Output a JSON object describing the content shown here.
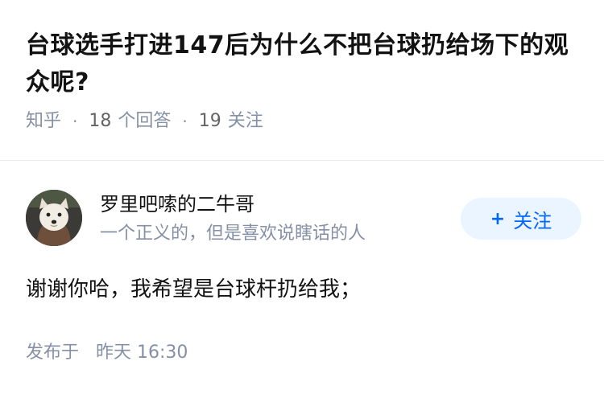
{
  "question": {
    "title": "台球选手打进147后为什么不把台球扔给场下的观众呢?",
    "source": "知乎",
    "separator": "·",
    "answers_count": "18",
    "answers_label": "个回答",
    "followers_count": "19",
    "followers_label": "关注"
  },
  "author": {
    "name": "罗里吧嗦的二牛哥",
    "bio": "一个正义的，但是喜欢说瞎话的人",
    "avatar_icon": "dog-avatar",
    "follow_plus": "+",
    "follow_label": "关注"
  },
  "answer": {
    "text": "谢谢你哈，我希望是台球杆扔给我；"
  },
  "footer": {
    "published_label": "发布于",
    "published_time": "昨天 16:30"
  },
  "colors": {
    "meta_gray": "#8590a6",
    "title_black": "#121212",
    "accent_blue": "#0066ff",
    "follow_bg": "#ebf5ff"
  }
}
